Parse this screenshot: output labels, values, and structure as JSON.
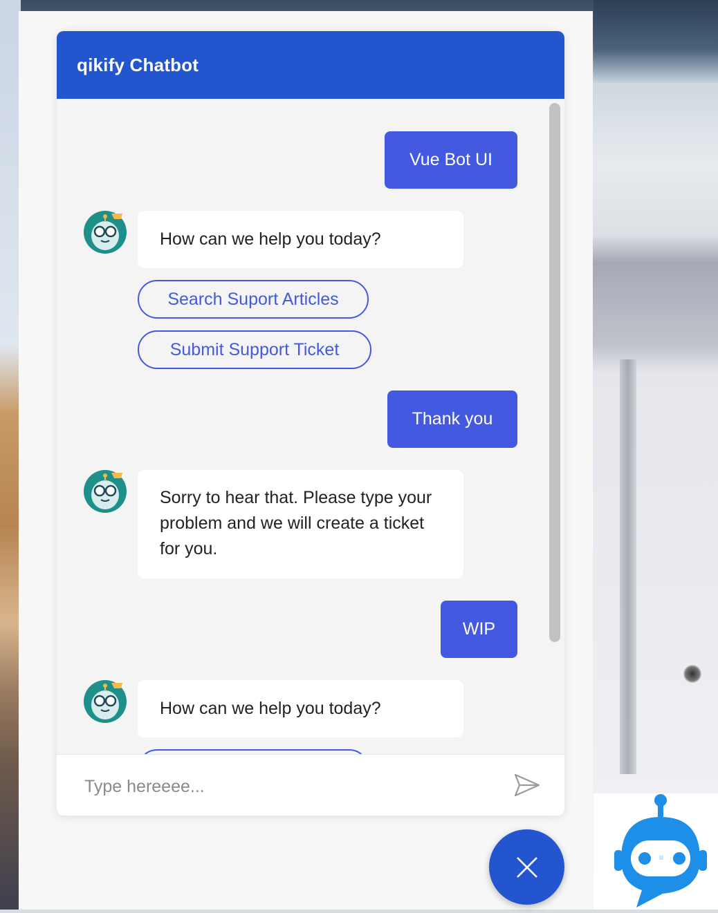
{
  "chat": {
    "title": "qikify Chatbot",
    "messages": [
      {
        "sender": "user",
        "text": "Vue Bot UI"
      },
      {
        "sender": "bot",
        "text": "How can we help you today?"
      },
      {
        "sender": "bot-options",
        "options": [
          "Search Suport Articles",
          "Submit Support Ticket"
        ]
      },
      {
        "sender": "user",
        "text": "Thank you"
      },
      {
        "sender": "bot",
        "text": "Sorry to hear that. Please type your problem and we will create a ticket for you."
      },
      {
        "sender": "user",
        "text": "WIP"
      },
      {
        "sender": "bot",
        "text": "How can we help you today?"
      }
    ],
    "input": {
      "placeholder": "Type hereeee...",
      "value": ""
    }
  },
  "icons": {
    "avatar": "robot-avatar-icon",
    "send": "send-icon",
    "close": "close-icon",
    "launcher": "robot-logo-icon"
  },
  "colors": {
    "header": "#2355cf",
    "user_bubble": "#4359df",
    "bot_bubble": "#ffffff",
    "board": "#f4f4f4"
  }
}
